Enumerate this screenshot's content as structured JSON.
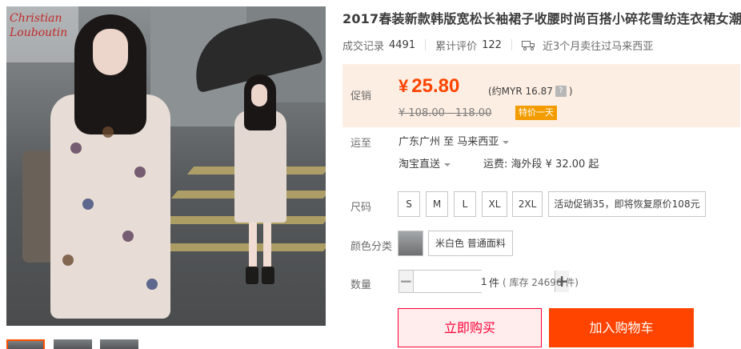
{
  "product": {
    "title": "2017春装新款韩版宽松长袖裙子收腰时尚百搭小碎花雪纺连衣裙女潮"
  },
  "image_watermark": "Christian Louboutin",
  "stats": {
    "deals_label": "成交记录",
    "deals_count": "4491",
    "reviews_label": "累计评价",
    "reviews_count": "122",
    "shipping_note": "近3个月卖往过马来西亚"
  },
  "price": {
    "label": "促销",
    "currency_symbol": "¥",
    "value": "25.80",
    "approx_prefix": "(约MYR 16.87",
    "approx_help": "?",
    "approx_suffix": ")",
    "original": "¥ 108.00 - 118.00",
    "promo_tag": "特价一天"
  },
  "shipping": {
    "label": "运至",
    "from_to": "广东广州 至  马来西亚",
    "method": "淘宝直送",
    "fee": "运费: 海外段 ¥ 32.00 起"
  },
  "size": {
    "label": "尺码",
    "options": [
      "S",
      "M",
      "L",
      "XL",
      "2XL",
      "活动促销35，即将恢复原价108元"
    ]
  },
  "color": {
    "label": "颜色分类",
    "option": "米白色 普通面料"
  },
  "quantity": {
    "label": "数量",
    "value": "1",
    "minus": "−",
    "plus": "+",
    "unit": "件",
    "stock": "( 库存 24696 件)"
  },
  "actions": {
    "buy_now": "立即购买",
    "add_to_cart": "加入购物车"
  },
  "colors": {
    "accent": "#ff4400",
    "buy_border": "#ff0036",
    "price_bg": "#fdeee3",
    "tag_bg": "#f39c00"
  }
}
